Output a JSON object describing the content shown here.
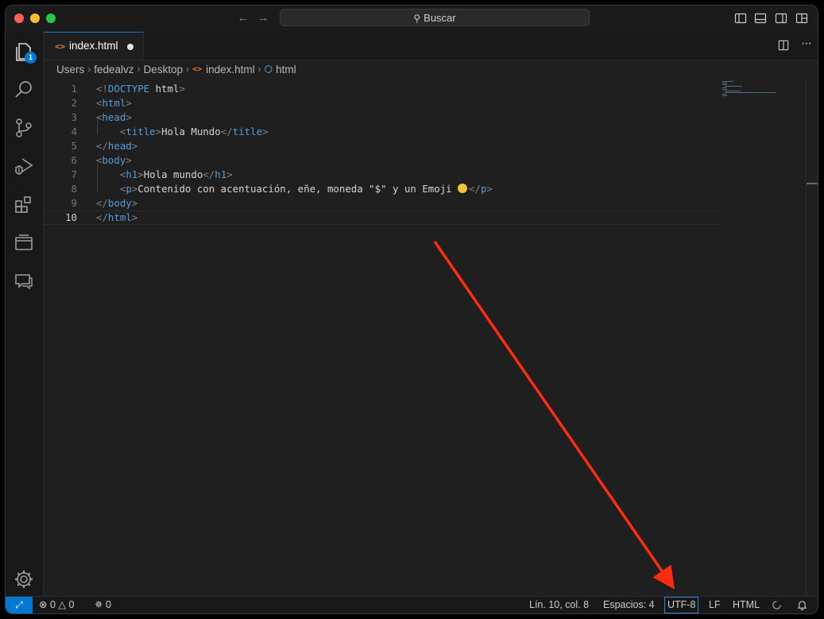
{
  "titlebar": {
    "search_label": "Buscar",
    "nav_back_icon": "arrow-left-icon",
    "nav_forward_icon": "arrow-right-icon",
    "traffic_lights": [
      "#ff5f57",
      "#febc2e",
      "#28c840"
    ]
  },
  "activitybar": {
    "items": [
      {
        "name": "explorer",
        "icon": "files-icon",
        "badge": "1"
      },
      {
        "name": "search",
        "icon": "search-icon"
      },
      {
        "name": "source-control",
        "icon": "source-control-icon"
      },
      {
        "name": "run-debug",
        "icon": "run-debug-icon"
      },
      {
        "name": "extensions",
        "icon": "extensions-icon"
      },
      {
        "name": "remote-explorer",
        "icon": "remote-explorer-icon"
      },
      {
        "name": "chat",
        "icon": "chat-icon"
      }
    ],
    "settings_icon": "gear-icon"
  },
  "tabs": [
    {
      "label": "index.html",
      "icon": "<>",
      "modified": true,
      "active": true
    }
  ],
  "breadcrumb": {
    "items": [
      "Users",
      "fedealvz",
      "Desktop",
      "index.html",
      "html"
    ]
  },
  "editor": {
    "line_numbers": [
      "1",
      "2",
      "3",
      "4",
      "5",
      "6",
      "7",
      "8",
      "9",
      "10"
    ],
    "current_line": "10",
    "lines": [
      [
        [
          "<!",
          "punct"
        ],
        [
          "DOCTYPE",
          "doc"
        ],
        [
          " html",
          "text"
        ],
        [
          ">",
          "punct"
        ]
      ],
      [
        [
          "<",
          "punct"
        ],
        [
          "html",
          "tag"
        ],
        [
          ">",
          "punct"
        ]
      ],
      [
        [
          "<",
          "punct"
        ],
        [
          "head",
          "tag"
        ],
        [
          ">",
          "punct"
        ]
      ],
      [
        [
          "    ",
          "text"
        ],
        [
          "<",
          "punct"
        ],
        [
          "title",
          "tag"
        ],
        [
          ">",
          "punct"
        ],
        [
          "Hola Mundo",
          "text"
        ],
        [
          "</",
          "punct"
        ],
        [
          "title",
          "tag"
        ],
        [
          ">",
          "punct"
        ]
      ],
      [
        [
          "</",
          "punct"
        ],
        [
          "head",
          "tag"
        ],
        [
          ">",
          "punct"
        ]
      ],
      [
        [
          "<",
          "punct"
        ],
        [
          "body",
          "tag"
        ],
        [
          ">",
          "punct"
        ]
      ],
      [
        [
          "    ",
          "text"
        ],
        [
          "<",
          "punct"
        ],
        [
          "h1",
          "tag"
        ],
        [
          ">",
          "punct"
        ],
        [
          "Hola mundo",
          "text"
        ],
        [
          "</",
          "punct"
        ],
        [
          "h1",
          "tag"
        ],
        [
          ">",
          "punct"
        ]
      ],
      [
        [
          "    ",
          "text"
        ],
        [
          "<",
          "punct"
        ],
        [
          "p",
          "tag"
        ],
        [
          ">",
          "punct"
        ],
        [
          "Contenido con acentuación, eñe, moneda \"$\" y un Emoji ",
          "text"
        ],
        [
          "EMOJI",
          "emoji"
        ],
        [
          "</",
          "punct"
        ],
        [
          "p",
          "tag"
        ],
        [
          ">",
          "punct"
        ]
      ],
      [
        [
          "</",
          "punct"
        ],
        [
          "body",
          "tag"
        ],
        [
          ">",
          "punct"
        ]
      ],
      [
        [
          "</",
          "punct"
        ],
        [
          "html",
          "tag"
        ],
        [
          ">",
          "punct"
        ]
      ]
    ]
  },
  "statusbar": {
    "errors": "0",
    "warnings": "0",
    "ports": "0",
    "cursor": "Lín. 10, col. 8",
    "spaces": "Espacios: 4",
    "encoding": "UTF-8",
    "eol": "LF",
    "language": "HTML"
  },
  "annotation": {
    "color": "#ff2a12"
  }
}
